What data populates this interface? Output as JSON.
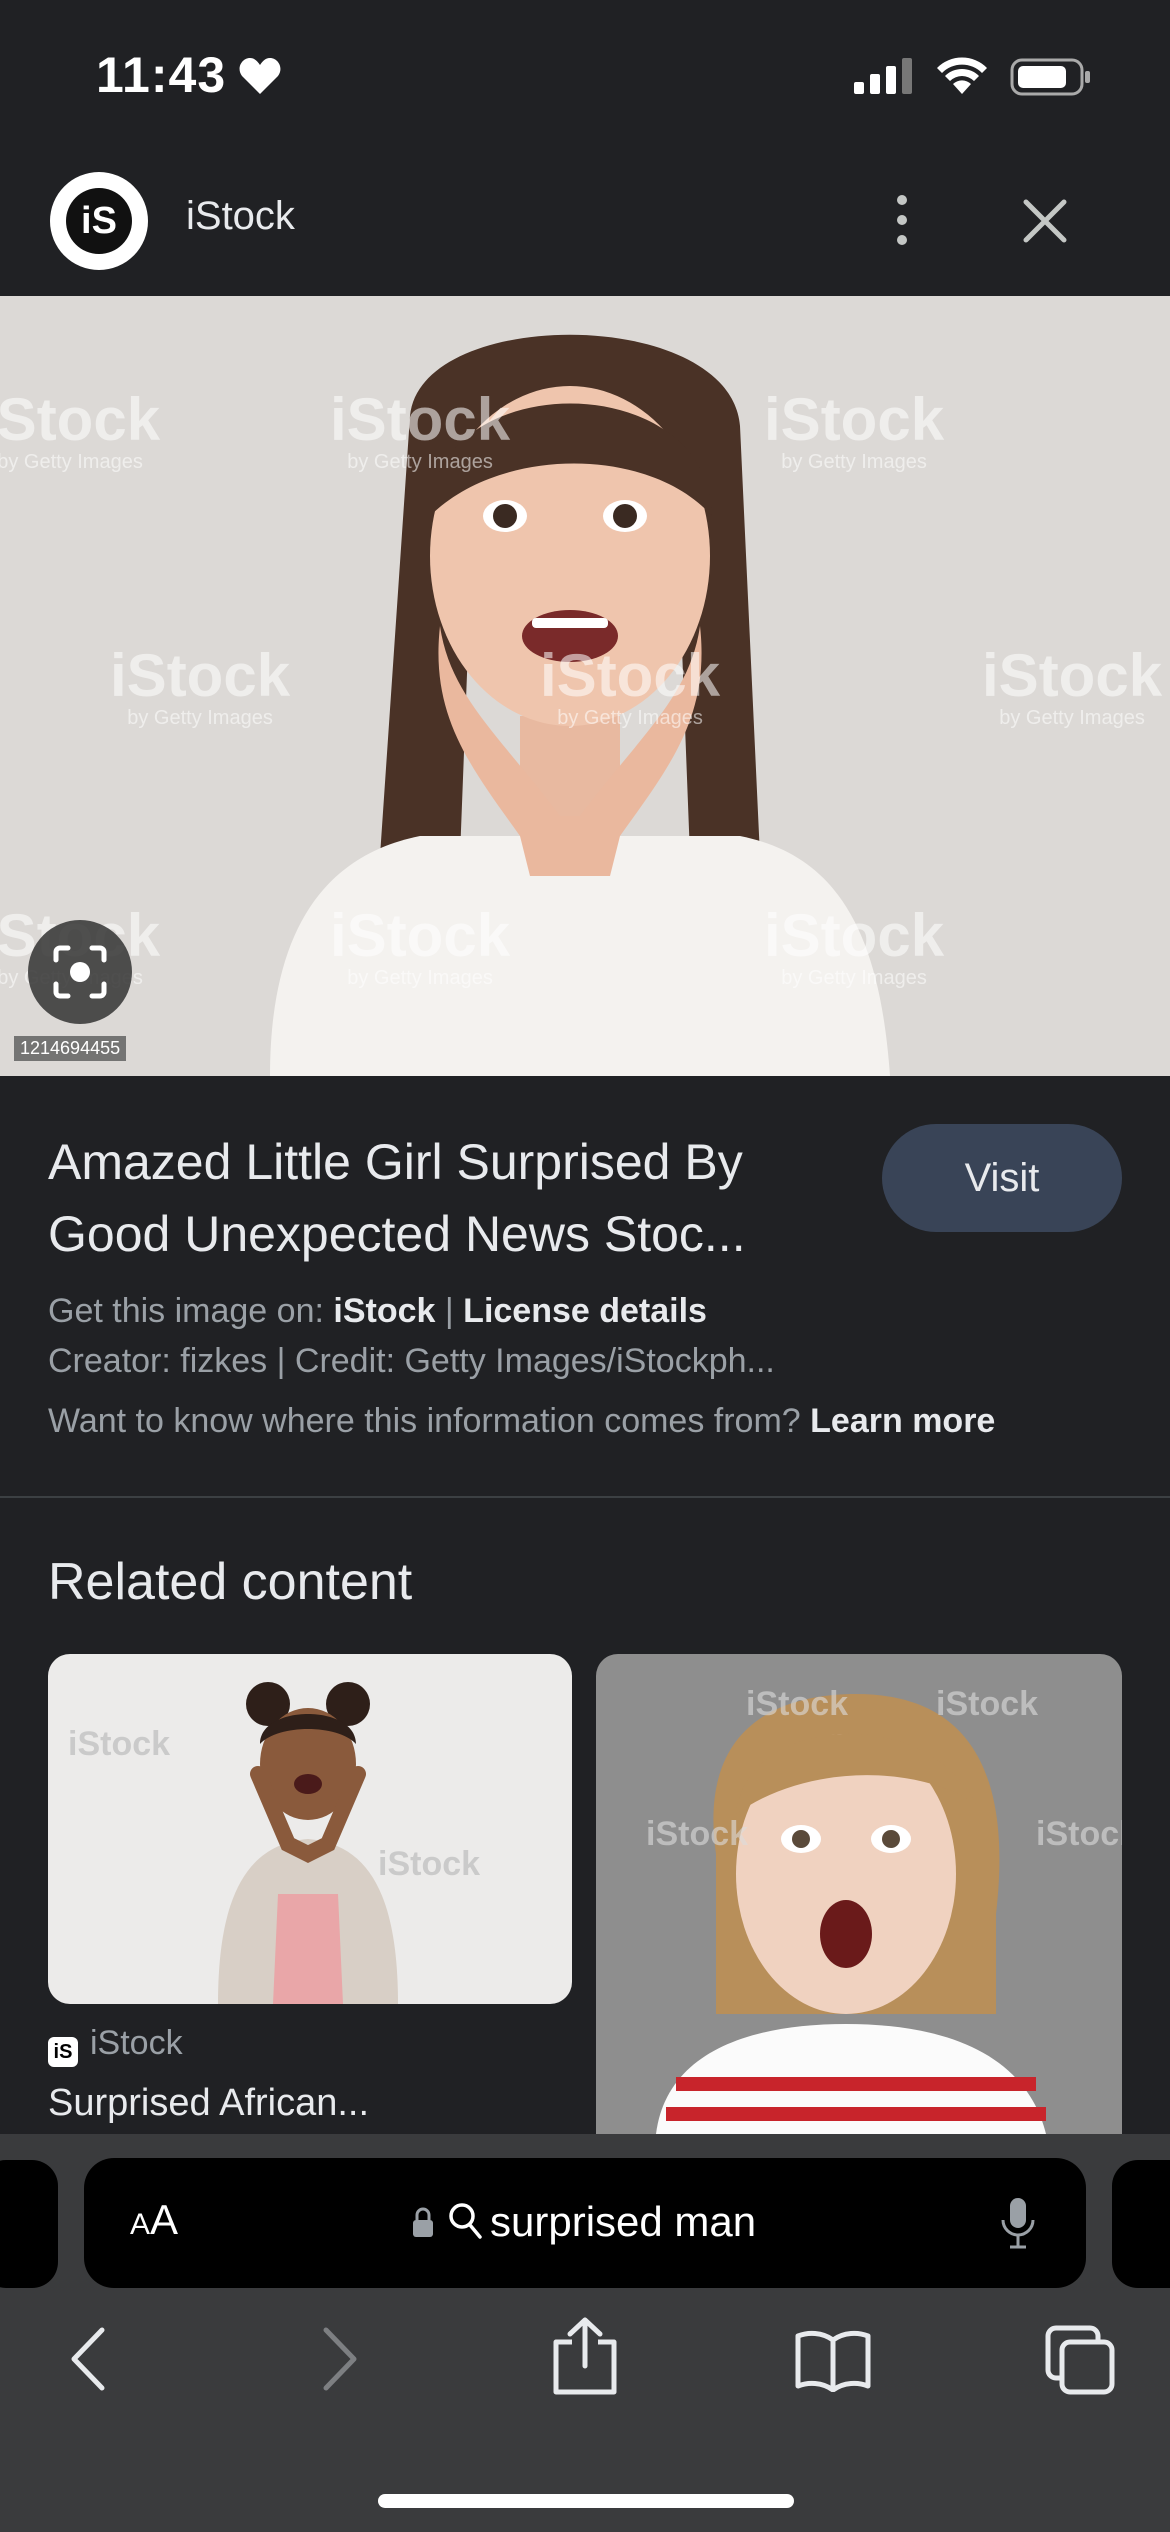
{
  "status_bar": {
    "time": "11:43"
  },
  "header": {
    "site_name": "iStock",
    "logo_text": "iS"
  },
  "hero": {
    "watermark": "iStock",
    "watermark_sub": "by Getty Images",
    "image_id": "1214694455"
  },
  "result": {
    "title": "Amazed Little Girl Surprised By Good Unexpected News Stoc...",
    "visit_label": "Visit",
    "get_image_prefix": "Get this image on:",
    "get_image_site": "iStock",
    "separator": "|",
    "license_label": "License details",
    "creator_line": "Creator: fizkes | Credit: Getty Images/iStockph...",
    "info_prefix": "Want to know where this information comes from?",
    "learn_more": "Learn more"
  },
  "related": {
    "heading": "Related content",
    "cards": [
      {
        "source": "iStock",
        "title": "Surprised African..."
      },
      {
        "source": "iStock",
        "title": ""
      }
    ]
  },
  "browser": {
    "aa_small": "A",
    "aa_large": "A",
    "address": "surprised man"
  },
  "colors": {
    "background": "#202124",
    "visit_button": "#394457",
    "toolbar": "#3a3b3d"
  }
}
